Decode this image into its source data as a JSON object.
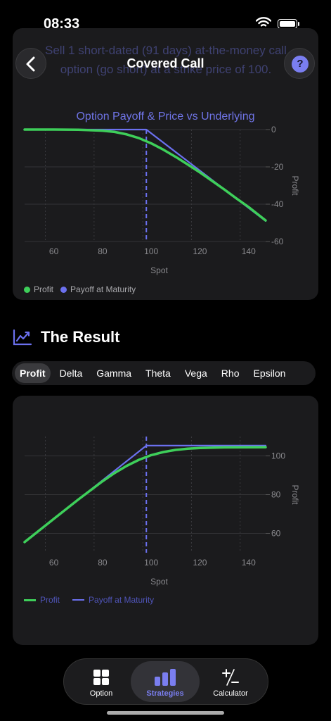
{
  "status": {
    "time": "08:33"
  },
  "nav": {
    "title": "Covered Call",
    "help": "?"
  },
  "strategy": {
    "description": "Sell 1 short-dated (91 days) at-the-money call option (go short) at a strike price of 100."
  },
  "chart1_title": "Option Payoff & Price vs Underlying",
  "result": {
    "title": "The Result"
  },
  "tabs": [
    "Profit",
    "Delta",
    "Gamma",
    "Theta",
    "Vega",
    "Rho",
    "Epsilon"
  ],
  "active_tab": "Profit",
  "tabbar": {
    "items": [
      {
        "label": "Option",
        "icon": "grid-icon"
      },
      {
        "label": "Strategies",
        "icon": "bar-chart-icon"
      },
      {
        "label": "Calculator",
        "icon": "plus-minus-icon"
      }
    ],
    "active": "Strategies"
  },
  "colors": {
    "profit": "#3ecf5a",
    "payoff": "#6b70ee",
    "accent": "#7a7ef0",
    "card": "#1b1b1d"
  },
  "chart_data": [
    {
      "type": "line",
      "title": "Option Payoff & Price vs Underlying",
      "xlabel": "Spot",
      "ylabel": "Profit",
      "xlim": [
        48,
        147
      ],
      "ylim": [
        -60,
        0
      ],
      "xticks": [
        60,
        80,
        100,
        120,
        140
      ],
      "yticks": [
        0,
        -20,
        -40,
        -60
      ],
      "marker_x": 98,
      "series": [
        {
          "name": "Profit",
          "color": "#3ecf5a",
          "x": [
            48,
            60,
            70,
            80,
            85,
            90,
            95,
            100,
            105,
            110,
            115,
            120,
            125,
            130,
            135,
            140,
            147
          ],
          "y": [
            0,
            0,
            -0.1,
            -0.6,
            -1.3,
            -2.6,
            -4.6,
            -7.4,
            -10.8,
            -14.6,
            -18.7,
            -23.0,
            -27.5,
            -32.1,
            -36.9,
            -41.5,
            -48.7
          ]
        },
        {
          "name": "Payoff at Maturity",
          "color": "#6b70ee",
          "x": [
            48,
            98,
            147
          ],
          "y": [
            0,
            0,
            -49
          ]
        }
      ]
    },
    {
      "type": "line",
      "xlabel": "Spot",
      "ylabel": "Profit",
      "xlim": [
        48,
        147
      ],
      "ylim": [
        50,
        110
      ],
      "xticks": [
        60,
        80,
        100,
        120,
        140
      ],
      "yticks": [
        100,
        80,
        60
      ],
      "marker_x": 98,
      "series": [
        {
          "name": "Profit",
          "color": "#3ecf5a",
          "x": [
            48,
            60,
            70,
            80,
            85,
            90,
            95,
            100,
            105,
            110,
            115,
            120,
            130,
            147
          ],
          "y": [
            55.5,
            67.5,
            77.4,
            86.9,
            91.2,
            94.9,
            98.0,
            100.4,
            102.0,
            103.1,
            103.7,
            104.1,
            104.4,
            104.5
          ]
        },
        {
          "name": "Payoff at Maturity",
          "color": "#6b70ee",
          "x": [
            48,
            98,
            147
          ],
          "y": [
            55.5,
            105.3,
            105.3
          ]
        }
      ]
    }
  ]
}
